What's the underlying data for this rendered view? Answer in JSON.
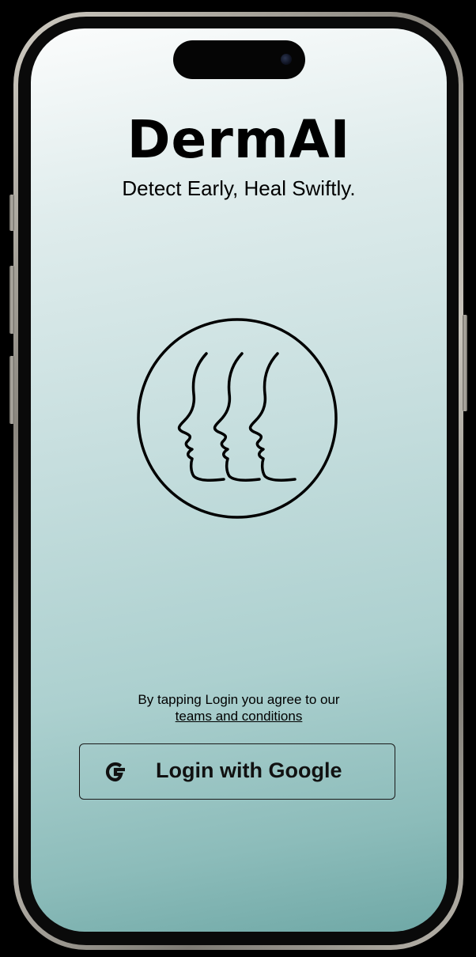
{
  "app": {
    "title": "DermAI",
    "tagline": "Detect Early, Heal Swiftly."
  },
  "logo": {
    "icon": "faces-profile-circle-icon"
  },
  "terms": {
    "text": "By tapping Login you agree to our",
    "link_label": "teams and conditions"
  },
  "login": {
    "label": "Login with Google",
    "icon": "google-g-icon"
  },
  "colors": {
    "gradient_top": "#fbfcfc",
    "gradient_bottom": "#6fa8a6",
    "text": "#000000"
  }
}
